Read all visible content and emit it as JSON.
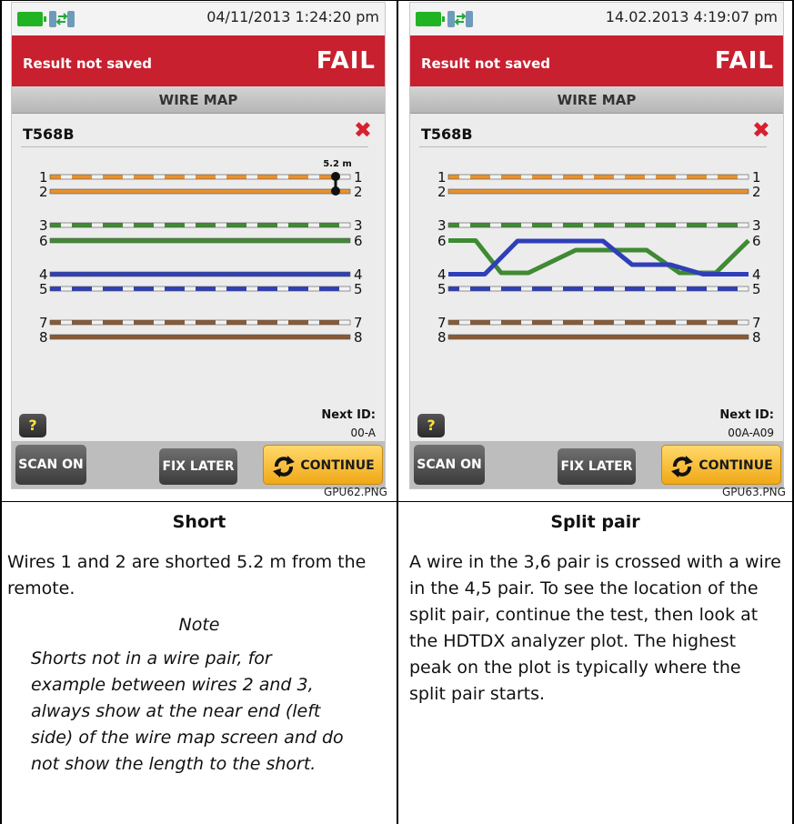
{
  "panels": [
    {
      "id": "short",
      "clock": "04/11/2013 1:24:20 pm",
      "status": "Result not saved",
      "result": "FAIL",
      "screen_title": "WIRE MAP",
      "standard": "T568B",
      "short_distance": "5.2 m",
      "pins": [
        "1",
        "2",
        "3",
        "6",
        "4",
        "5",
        "7",
        "8"
      ],
      "next_id_label": "Next ID:",
      "next_id": "00-A",
      "help": "?",
      "buttons": {
        "scan": "SCAN ON",
        "fix": "FIX LATER",
        "continue": "CONTINUE"
      },
      "filename": "GPU62.PNG",
      "caption_title": "Short",
      "caption_text": "Wires 1 and 2 are shorted 5.2 m from the remote.",
      "note_title": "Note",
      "note_text": "Shorts not in a wire pair, for example between wires 2 and 3, always show at the near end (left side) of the wire map screen and do not show the length to the short."
    },
    {
      "id": "split",
      "clock": "14.02.2013 4:19:07 pm",
      "status": "Result not saved",
      "result": "FAIL",
      "screen_title": "WIRE MAP",
      "standard": "T568B",
      "pins": [
        "1",
        "2",
        "3",
        "6",
        "4",
        "5",
        "7",
        "8"
      ],
      "next_id_label": "Next ID:",
      "next_id": "00A-A09",
      "help": "?",
      "buttons": {
        "scan": "SCAN ON",
        "fix": "FIX LATER",
        "continue": "CONTINUE"
      },
      "filename": "GPU63.PNG",
      "caption_title": "Split pair",
      "caption_text": "A wire in the 3,6 pair is crossed with a wire in the 4,5 pair. To see the location of the split pair, continue the test, then look at the HDTDX analyzer plot. The highest peak on the plot is typically where the split pair starts."
    }
  ],
  "colors": {
    "orange": "#e8912e",
    "green": "#3f8a33",
    "blue": "#2f3fb8",
    "brown": "#8b5a33",
    "fail_red": "#c8202f"
  }
}
